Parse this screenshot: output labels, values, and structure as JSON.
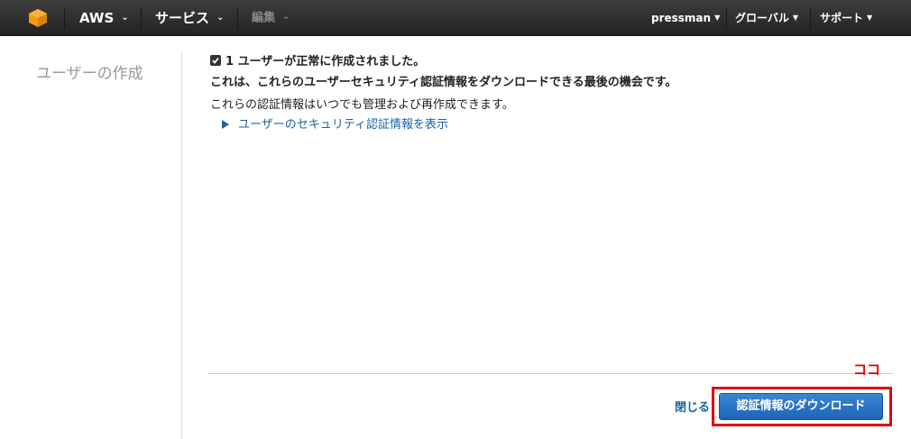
{
  "nav": {
    "aws_label": "AWS",
    "services_label": "サービス",
    "edit_label": "編集",
    "user_label": "pressman",
    "region_label": "グローバル",
    "support_label": "サポート"
  },
  "sidebar": {
    "title": "ユーザーの作成"
  },
  "main": {
    "success_message": "1 ユーザーが正常に作成されました。",
    "last_chance_message": "これは、これらのユーザーセキュリティ認証情報をダウンロードできる最後の機会です。",
    "info_message": "これらの認証情報はいつでも管理および再作成できます。",
    "show_credentials_link": "ユーザーのセキュリティ認証情報を表示"
  },
  "footer": {
    "close_label": "閉じる",
    "download_label": "認証情報のダウンロード"
  },
  "annotation": {
    "text": "ココ",
    "color": "#e00000"
  },
  "colors": {
    "accent": "#1a63a7",
    "button": "#2a75c8",
    "topbar": "#2f2f2f"
  },
  "icons": [
    "aws-logo-icon",
    "chevron-down-icon",
    "checkbox-checked-icon",
    "triangle-right-icon"
  ]
}
